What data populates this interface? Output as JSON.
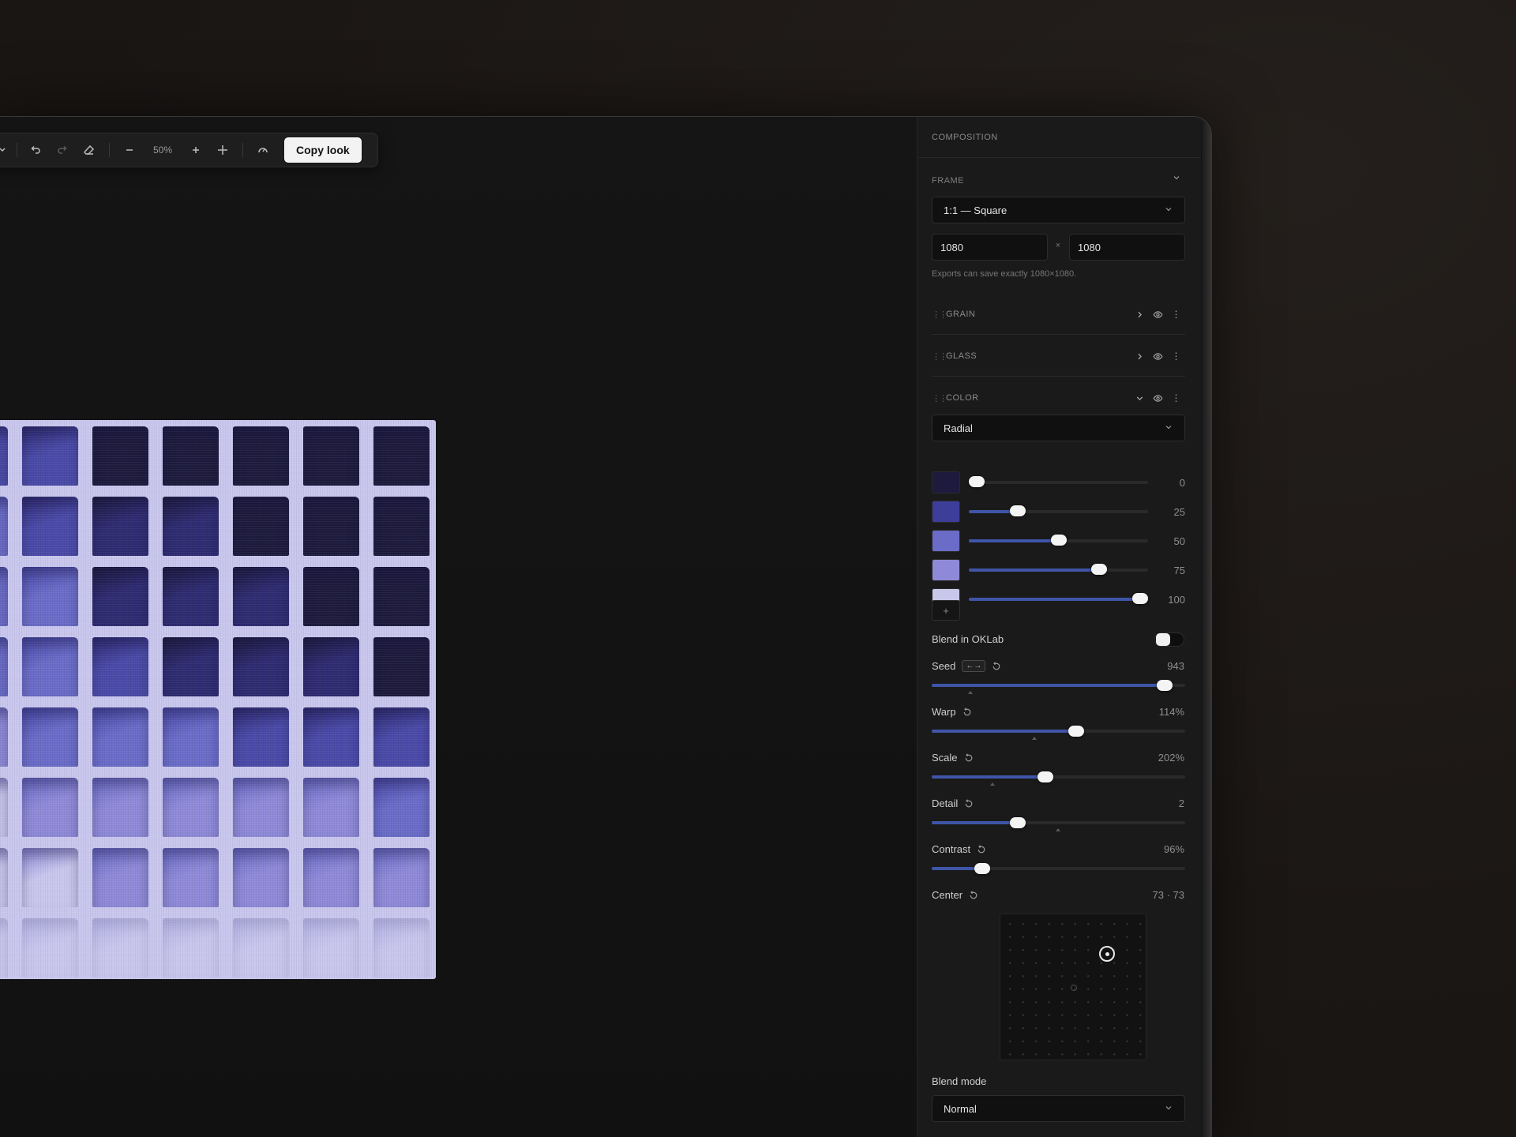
{
  "toolbar": {
    "zoom": "50%",
    "copy_look": "Copy look"
  },
  "panel": {
    "title": "COMPOSITION",
    "frame": {
      "label": "FRAME",
      "preset": "1:1 — Square",
      "width": "1080",
      "height": "1080",
      "times": "×",
      "hint": "Exports can save exactly 1080×1080."
    },
    "layers": [
      {
        "name": "GRAIN"
      },
      {
        "name": "GLASS"
      },
      {
        "name": "COLOR"
      }
    ],
    "color": {
      "mode": "Radial",
      "stops": [
        {
          "value": "0",
          "position": 0,
          "color": "#1d1a3d"
        },
        {
          "value": "25",
          "position": 25,
          "color": "#3d3d9a"
        },
        {
          "value": "50",
          "position": 50,
          "color": "#6a6cc8"
        },
        {
          "value": "75",
          "position": 75,
          "color": "#8f8ad8"
        },
        {
          "value": "100",
          "position": 100,
          "color": "#c9c8ea"
        }
      ],
      "add": "+",
      "blend_oklab": "Blend in OKLab",
      "blend_oklab_on": false
    },
    "params": {
      "seed": {
        "label": "Seed",
        "value": "943",
        "arrows": "←→",
        "level": 0.92
      },
      "warp": {
        "label": "Warp",
        "value": "114%",
        "level": 0.57
      },
      "scale": {
        "label": "Scale",
        "value": "202%",
        "level": 0.45
      },
      "detail": {
        "label": "Detail",
        "value": "2",
        "level": 0.34
      },
      "contrast": {
        "label": "Contrast",
        "value": "96%",
        "level": 0.2
      },
      "center": {
        "label": "Center",
        "value": "73 · 73"
      }
    },
    "blend_mode": {
      "label": "Blend mode",
      "value": "Normal"
    }
  },
  "colors": {
    "accent": "#3f55a8",
    "artwork_light": "#c9c7ee",
    "artwork_mid": "#6a6cc8",
    "artwork_dark": "#1d1a3d"
  }
}
